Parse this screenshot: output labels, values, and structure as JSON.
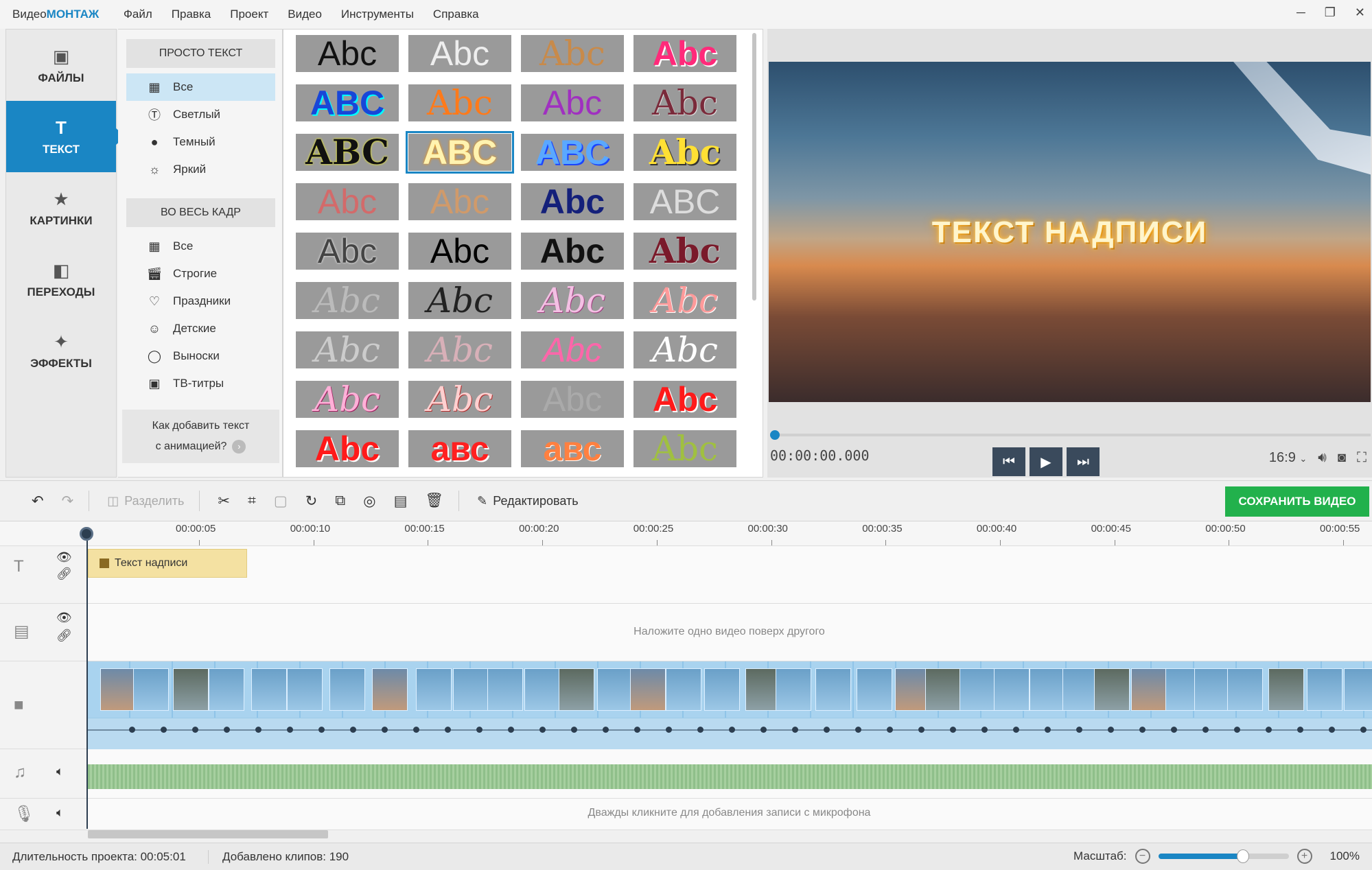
{
  "app": {
    "logo_prefix": "Видео",
    "logo_bold": "МОНТАЖ"
  },
  "menu": [
    "Файл",
    "Правка",
    "Проект",
    "Видео",
    "Инструменты",
    "Справка"
  ],
  "nav": [
    {
      "label": "ФАЙЛЫ",
      "icon": "image-icon"
    },
    {
      "label": "ТЕКСТ",
      "icon": "text-icon"
    },
    {
      "label": "КАРТИНКИ",
      "icon": "star-icon"
    },
    {
      "label": "ПЕРЕХОДЫ",
      "icon": "transition-icon"
    },
    {
      "label": "ЭФФЕКТЫ",
      "icon": "magic-wand-icon"
    }
  ],
  "categories": {
    "section1": "ПРОСТО ТЕКСТ",
    "items1": [
      "Все",
      "Светлый",
      "Темный",
      "Яркий"
    ],
    "section2": "ВО ВЕСЬ КАДР",
    "items2": [
      "Все",
      "Строгие",
      "Праздники",
      "Детские",
      "Выноски",
      "ТВ-титры"
    ],
    "howto_line1": "Как добавить текст",
    "howto_line2": "с анимацией?"
  },
  "tiles": [
    "Abc",
    "Abc",
    "Abc",
    "Abc",
    "ABC",
    "Abc",
    "Abc",
    "Abc",
    "ABC",
    "ABC",
    "ABC",
    "Abc",
    "Abc",
    "Abc",
    "Abc",
    "ABC",
    "Abc",
    "Abc",
    "Abc",
    "Abc",
    "Abc",
    "Abc",
    "Abc",
    "Abc",
    "Abc",
    "Abc",
    "Abc",
    "Abc",
    "Abc",
    "Abc",
    "Abc",
    "Abc",
    "Abc",
    "авс",
    "авс",
    "Abc"
  ],
  "preview": {
    "overlay_text": "ТЕКСТ НАДПИСИ",
    "timecode": "00:00:00.000",
    "aspect": "16:9",
    "progress": 0
  },
  "toolbar": {
    "split": "Разделить",
    "edit": "Редактировать",
    "save": "СОХРАНИТЬ ВИДЕО"
  },
  "ruler": [
    "00:00:05",
    "00:00:10",
    "00:00:15",
    "00:00:20",
    "00:00:25",
    "00:00:30",
    "00:00:35",
    "00:00:40",
    "00:00:45",
    "00:00:50",
    "00:00:55"
  ],
  "tracks": {
    "text_clip": "Текст надписи",
    "overlay_hint": "Наложите одно видео поверх другого",
    "mic_hint": "Дважды кликните для добавления записи с микрофона"
  },
  "status": {
    "duration": "Длительность проекта:  00:05:01",
    "clips": "Добавлено клипов: 190",
    "zoom_label": "Масштаб:",
    "zoom_value": "100%",
    "zoom_level": 0.65
  },
  "colors": {
    "accent": "#1a86c4",
    "save": "#22b14c"
  }
}
